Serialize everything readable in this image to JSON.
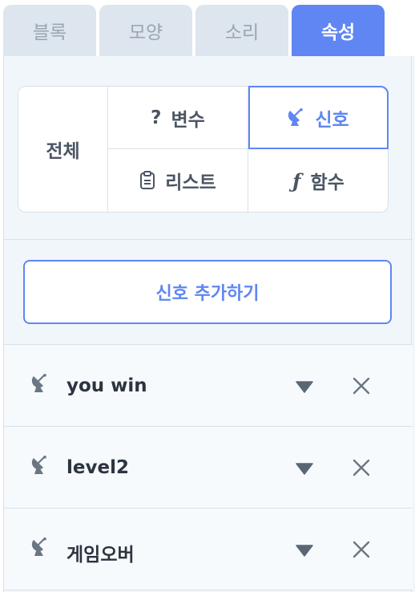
{
  "tabs": [
    {
      "label": "블록",
      "active": false
    },
    {
      "label": "모양",
      "active": false
    },
    {
      "label": "소리",
      "active": false
    },
    {
      "label": "속성",
      "active": true
    }
  ],
  "filter": {
    "all_label": "전체",
    "variable_label": "변수",
    "variable_icon": "?",
    "signal_label": "신호",
    "list_label": "리스트",
    "function_label": "함수",
    "function_icon": "ƒ",
    "selected": "신호"
  },
  "add_signal_label": "신호 추가하기",
  "signals": [
    {
      "name": "you win"
    },
    {
      "name": "level2"
    },
    {
      "name": "게임오버"
    }
  ],
  "colors": {
    "accent": "#5f86f2",
    "tab_inactive": "#dde5ee",
    "panel_bg": "#f1f6fb",
    "icon_gray": "#6b7683"
  }
}
